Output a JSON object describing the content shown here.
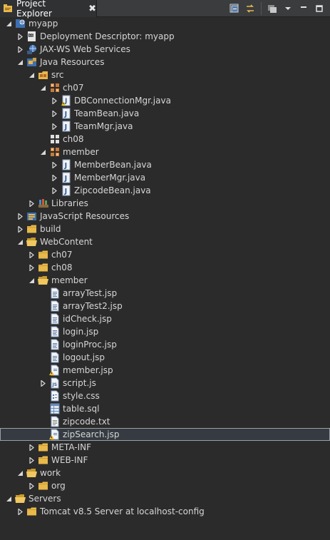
{
  "tab": {
    "title": "Project Explorer",
    "close": "✖"
  },
  "tree": [
    {
      "depth": 0,
      "state": "expanded",
      "icon": "project-icon",
      "label": "myapp"
    },
    {
      "depth": 1,
      "state": "collapsed",
      "icon": "deployment-descriptor-icon",
      "label": "Deployment Descriptor: myapp"
    },
    {
      "depth": 1,
      "state": "collapsed",
      "icon": "web-services-icon",
      "label": "JAX-WS Web Services"
    },
    {
      "depth": 1,
      "state": "expanded",
      "icon": "java-resources-icon",
      "label": "Java Resources"
    },
    {
      "depth": 2,
      "state": "expanded",
      "icon": "source-folder-icon",
      "label": "src"
    },
    {
      "depth": 3,
      "state": "expanded",
      "icon": "package-icon",
      "label": "ch07"
    },
    {
      "depth": 4,
      "state": "collapsed",
      "icon": "java-file-warning-icon",
      "label": "DBConnectionMgr.java"
    },
    {
      "depth": 4,
      "state": "collapsed",
      "icon": "java-file-icon",
      "label": "TeamBean.java"
    },
    {
      "depth": 4,
      "state": "collapsed",
      "icon": "java-file-icon",
      "label": "TeamMgr.java"
    },
    {
      "depth": 3,
      "state": "none",
      "icon": "empty-package-icon",
      "label": "ch08"
    },
    {
      "depth": 3,
      "state": "expanded",
      "icon": "package-icon",
      "label": "member"
    },
    {
      "depth": 4,
      "state": "collapsed",
      "icon": "java-file-icon",
      "label": "MemberBean.java"
    },
    {
      "depth": 4,
      "state": "collapsed",
      "icon": "java-file-icon",
      "label": "MemberMgr.java"
    },
    {
      "depth": 4,
      "state": "collapsed",
      "icon": "java-file-icon",
      "label": "ZipcodeBean.java"
    },
    {
      "depth": 2,
      "state": "collapsed",
      "icon": "libraries-icon",
      "label": "Libraries"
    },
    {
      "depth": 1,
      "state": "collapsed",
      "icon": "javascript-resources-icon",
      "label": "JavaScript Resources"
    },
    {
      "depth": 1,
      "state": "collapsed",
      "icon": "folder-icon",
      "label": "build"
    },
    {
      "depth": 1,
      "state": "expanded",
      "icon": "folder-open-icon",
      "label": "WebContent"
    },
    {
      "depth": 2,
      "state": "collapsed",
      "icon": "folder-icon",
      "label": "ch07"
    },
    {
      "depth": 2,
      "state": "collapsed",
      "icon": "folder-icon",
      "label": "ch08"
    },
    {
      "depth": 2,
      "state": "expanded",
      "icon": "folder-open-icon",
      "label": "member"
    },
    {
      "depth": 3,
      "state": "none",
      "icon": "jsp-file-icon",
      "label": "arrayTest.jsp"
    },
    {
      "depth": 3,
      "state": "none",
      "icon": "jsp-file-icon",
      "label": "arrayTest2.jsp"
    },
    {
      "depth": 3,
      "state": "none",
      "icon": "jsp-file-icon",
      "label": "idCheck.jsp"
    },
    {
      "depth": 3,
      "state": "none",
      "icon": "jsp-file-icon",
      "label": "login.jsp"
    },
    {
      "depth": 3,
      "state": "none",
      "icon": "jsp-file-icon",
      "label": "loginProc.jsp"
    },
    {
      "depth": 3,
      "state": "none",
      "icon": "jsp-file-icon",
      "label": "logout.jsp"
    },
    {
      "depth": 3,
      "state": "none",
      "icon": "jsp-file-warning-icon",
      "label": "member.jsp"
    },
    {
      "depth": 3,
      "state": "collapsed",
      "icon": "js-file-icon",
      "label": "script.js"
    },
    {
      "depth": 3,
      "state": "none",
      "icon": "css-file-icon",
      "label": "style.css"
    },
    {
      "depth": 3,
      "state": "none",
      "icon": "sql-file-icon",
      "label": "table.sql"
    },
    {
      "depth": 3,
      "state": "none",
      "icon": "text-file-icon",
      "label": "zipcode.txt"
    },
    {
      "depth": 3,
      "state": "none",
      "icon": "jsp-file-warning-icon",
      "label": "zipSearch.jsp",
      "selected": true
    },
    {
      "depth": 2,
      "state": "collapsed",
      "icon": "folder-icon",
      "label": "META-INF"
    },
    {
      "depth": 2,
      "state": "collapsed",
      "icon": "folder-icon",
      "label": "WEB-INF"
    },
    {
      "depth": 1,
      "state": "expanded",
      "icon": "folder-open-icon",
      "label": "work"
    },
    {
      "depth": 2,
      "state": "collapsed",
      "icon": "folder-icon",
      "label": "org"
    },
    {
      "depth": 0,
      "state": "expanded",
      "icon": "folder-open-icon",
      "label": "Servers"
    },
    {
      "depth": 1,
      "state": "collapsed",
      "icon": "folder-icon",
      "label": "Tomcat v8.5 Server at localhost-config"
    }
  ]
}
